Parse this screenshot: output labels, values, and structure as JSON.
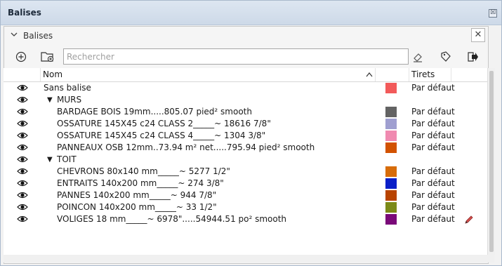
{
  "window": {
    "title": "Balises",
    "close_label": "☒"
  },
  "panel": {
    "title": "Balises",
    "close_label": "✕"
  },
  "search": {
    "placeholder": "Rechercher",
    "value": ""
  },
  "columns": {
    "name": "Nom",
    "dashes": "Tirets"
  },
  "icons": {
    "add": "add-tag-icon",
    "add_folder": "add-folder-icon",
    "paint": "paint-bucket-icon",
    "tag": "tag-icon",
    "export": "export-icon"
  },
  "rows": [
    {
      "name": "Sans balise",
      "color": "#f25a5a",
      "dash": "Par défaut",
      "folder": false
    },
    {
      "name": "MURS",
      "folder": true
    },
    {
      "name": "BARDAGE BOIS 19mm.....805.07 pied² smooth",
      "color": "#636363",
      "dash": "Par défaut",
      "folder": false
    },
    {
      "name": "OSSATURE 145X45 c24 CLASS 2_____~ 18616 7/8\"",
      "color": "#9f9fd0",
      "dash": "Par défaut",
      "folder": false
    },
    {
      "name": "OSSATURE 145X45 c24 CLASS 4_____~ 1304 3/8\"",
      "color": "#f08ab0",
      "dash": "Par défaut",
      "folder": false
    },
    {
      "name": "PANNEAUX OSB 12mm..73.94 m² net.....795.94 pied² smooth",
      "color": "#d25200",
      "dash": "Par défaut",
      "folder": false
    },
    {
      "name": "TOIT",
      "folder": true
    },
    {
      "name": "CHEVRONS 80x140 mm_____~ 5277 1/2\"",
      "color": "#d76c0a",
      "dash": "Par défaut",
      "folder": false
    },
    {
      "name": "ENTRAITS 140x200 mm_____~ 274 3/8\"",
      "color": "#0a1fc8",
      "dash": "Par défaut",
      "folder": false
    },
    {
      "name": "PANNES 140x200 mm_____~ 944 7/8\"",
      "color": "#b84300",
      "dash": "Par défaut",
      "folder": false
    },
    {
      "name": "POINCON 140x200 mm_____~ 33 1/2\"",
      "color": "#7c8a18",
      "dash": "Par défaut",
      "folder": false
    },
    {
      "name": "VOLIGES 18 mm_____~ 6978\".....54944.51 po² smooth",
      "color": "#7a0a79",
      "dash": "Par défaut",
      "folder": false,
      "active": true
    }
  ]
}
